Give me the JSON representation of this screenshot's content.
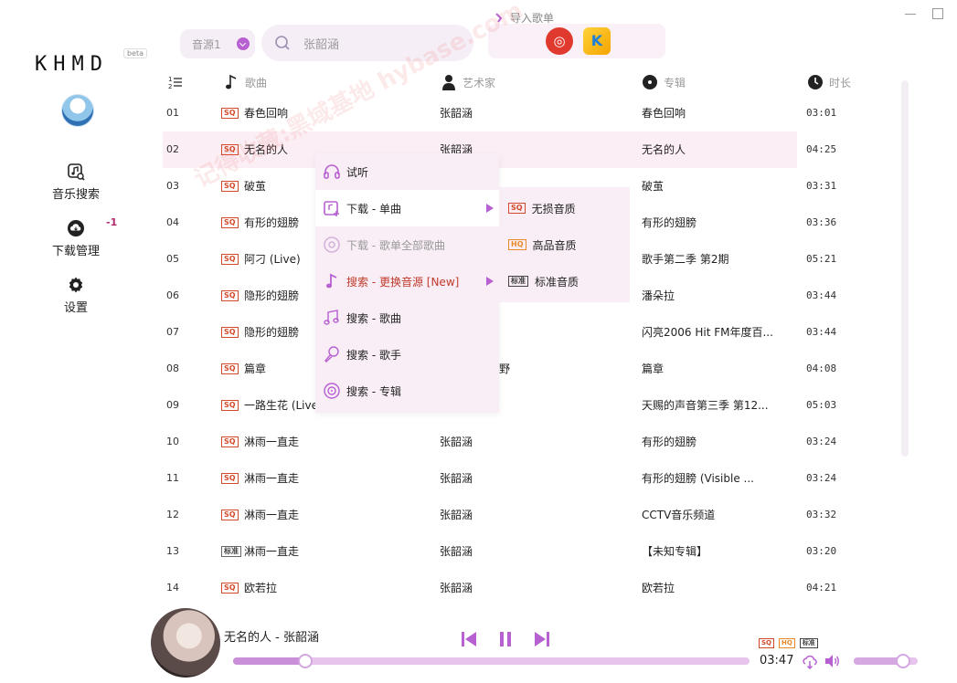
{
  "app": {
    "logo": "KHMD",
    "beta": "beta"
  },
  "sidebar": {
    "items": [
      {
        "label": "音乐搜索",
        "icon": "music-search-icon"
      },
      {
        "label": "下载管理",
        "icon": "cloud-download-icon",
        "badge": "-1"
      },
      {
        "label": "设置",
        "icon": "gear-icon"
      }
    ]
  },
  "topbar": {
    "source": "音源1",
    "search_value": "张韶涵",
    "import_label": "导入歌单"
  },
  "table": {
    "headers": {
      "title": "歌曲",
      "artist": "艺术家",
      "album": "专辑",
      "duration": "时长"
    },
    "rows": [
      {
        "idx": "01",
        "q": "SQ",
        "title": "春色回响",
        "artist": "张韶涵",
        "album": "春色回响",
        "dur": "03:01"
      },
      {
        "idx": "02",
        "q": "SQ",
        "title": "无名的人",
        "artist": "张韶涵",
        "album": "无名的人",
        "dur": "04:25"
      },
      {
        "idx": "03",
        "q": "SQ",
        "title": "破茧",
        "artist": "",
        "album": "破茧",
        "dur": "03:31"
      },
      {
        "idx": "04",
        "q": "SQ",
        "title": "有形的翅膀",
        "artist": "",
        "album": "有形的翅膀",
        "dur": "03:36"
      },
      {
        "idx": "05",
        "q": "SQ",
        "title": "阿刁 (Live)",
        "artist": "",
        "album": "歌手第二季 第2期",
        "dur": "05:21"
      },
      {
        "idx": "06",
        "q": "SQ",
        "title": "隐形的翅膀",
        "artist": "",
        "album": "潘朵拉",
        "dur": "03:44"
      },
      {
        "idx": "07",
        "q": "SQ",
        "title": "隐形的翅膀",
        "artist": "",
        "album": "闪亮2006 Hit FM年度百...",
        "dur": "03:44"
      },
      {
        "idx": "08",
        "q": "SQ",
        "title": "篇章",
        "artist": "野",
        "album": "篇章",
        "dur": "04:08"
      },
      {
        "idx": "09",
        "q": "SQ",
        "title": "一路生花 (Live",
        "artist": "",
        "album": "天赐的声音第三季 第12...",
        "dur": "05:03"
      },
      {
        "idx": "10",
        "q": "SQ",
        "title": "淋雨一直走",
        "artist": "张韶涵",
        "album": "有形的翅膀",
        "dur": "03:24"
      },
      {
        "idx": "11",
        "q": "SQ",
        "title": "淋雨一直走",
        "artist": "张韶涵",
        "album": "有形的翅膀 (Visible ...",
        "dur": "03:24"
      },
      {
        "idx": "12",
        "q": "SQ",
        "title": "淋雨一直走",
        "artist": "张韶涵",
        "album": "CCTV音乐频道",
        "dur": "03:32"
      },
      {
        "idx": "13",
        "q": "标准",
        "title": "淋雨一直走",
        "artist": "张韶涵",
        "album": "【未知专辑】",
        "dur": "03:20"
      },
      {
        "idx": "14",
        "q": "SQ",
        "title": "欧若拉",
        "artist": "张韶涵",
        "album": "欧若拉",
        "dur": "04:21"
      }
    ]
  },
  "context_menu": {
    "items": [
      {
        "label": "试听",
        "icon": "headphones-icon"
      },
      {
        "label": "下载 - 单曲",
        "icon": "download-add-icon"
      },
      {
        "label": "下载 - 歌单全部歌曲",
        "icon": "disc-icon"
      },
      {
        "label": "搜索 - 更换音源 [New]",
        "icon": "note-icon"
      },
      {
        "label": "搜索 - 歌曲",
        "icon": "music-notes-icon"
      },
      {
        "label": "搜索 - 歌手",
        "icon": "microphone-icon"
      },
      {
        "label": "搜索 - 专辑",
        "icon": "album-icon"
      }
    ]
  },
  "submenu": {
    "items": [
      {
        "q": "SQ",
        "label": "无损音质"
      },
      {
        "q": "HQ",
        "label": "高品音质"
      },
      {
        "q": "标准",
        "label": "标准音质"
      }
    ]
  },
  "watermark": "记得收藏:黑域基地 hybase.com",
  "player": {
    "now_playing": "无名的人 - 张韶涵",
    "time": "03:47",
    "quality_badges": [
      "SQ",
      "HQ",
      "标准"
    ],
    "progress": 0.14,
    "volume": 0.77
  },
  "colors": {
    "accent": "#b760d1",
    "sq": "#d24a2a",
    "hq": "#e88a2a",
    "highlight": "#fbeff5"
  }
}
